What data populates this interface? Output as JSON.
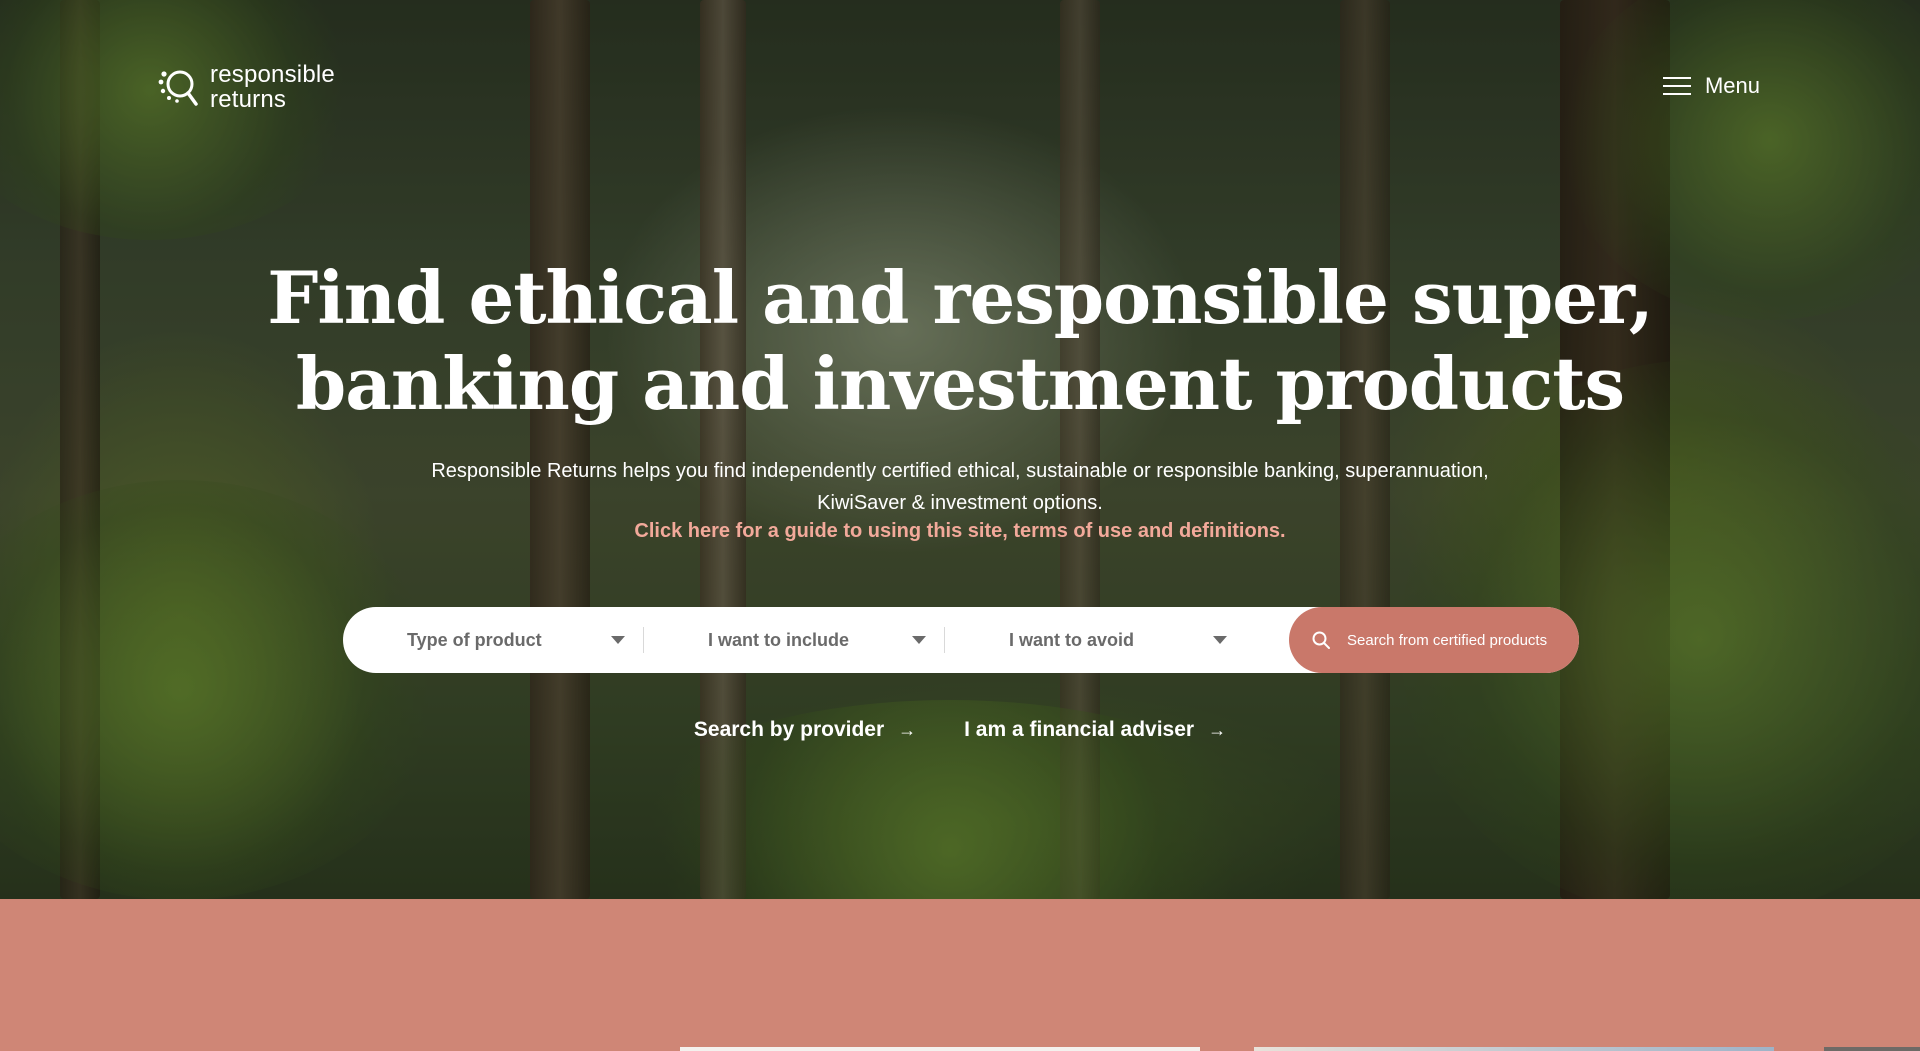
{
  "brand": {
    "name_line1": "responsible",
    "name_line2": "returns",
    "logo_icon": "search-dots-icon"
  },
  "nav": {
    "menu_label": "Menu",
    "menu_icon": "hamburger-icon"
  },
  "hero": {
    "headline_line1": "Find ethical and responsible super,",
    "headline_line2": "banking and investment products",
    "subtext_line1": "Responsible Returns helps you find independently certified ethical, sustainable or responsible banking, superannuation,",
    "subtext_line2": "KiwiSaver & investment options.",
    "guide_link": "Click here for a guide to using this site, terms of use and definitions."
  },
  "search": {
    "product_type_placeholder": "Type of product",
    "include_placeholder": "I want to include",
    "avoid_placeholder": "I want to avoid",
    "submit_label": "Search from certified products",
    "submit_icon": "search-icon"
  },
  "links": {
    "provider": "Search by provider",
    "adviser": "I am a financial adviser",
    "arrow": "→"
  },
  "colors": {
    "accent": "#c9786a",
    "lower_section": "#cf8676",
    "link_pink": "#f2a99a"
  }
}
